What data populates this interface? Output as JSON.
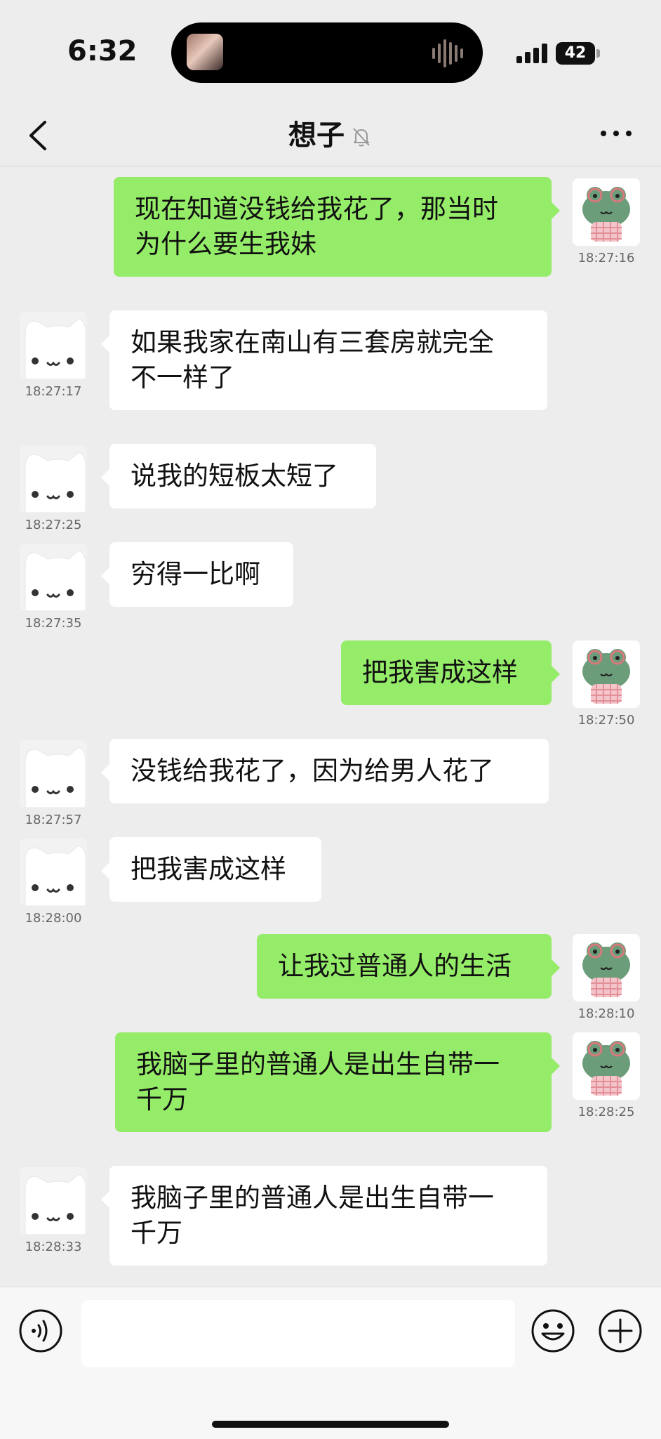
{
  "status_bar": {
    "time": "6:32",
    "battery": "42"
  },
  "nav": {
    "title": "想子"
  },
  "messages": [
    {
      "text": "现在知道没钱给我花了，那当时\n为什么要生我妹",
      "time": "18:27:16"
    },
    {
      "text": "如果我家在南山有三套房就完全\n不一样了",
      "time": "18:27:17"
    },
    {
      "text": "说我的短板太短了",
      "time": "18:27:25"
    },
    {
      "text": "穷得一比啊",
      "time": "18:27:35"
    },
    {
      "text": "把我害成这样",
      "time": "18:27:50"
    },
    {
      "text": "没钱给我花了，因为给男人花了",
      "time": "18:27:57"
    },
    {
      "text": "把我害成这样",
      "time": "18:28:00"
    },
    {
      "text": "让我过普通人的生活",
      "time": "18:28:10"
    },
    {
      "text": "我脑子里的普通人是出生自带一\n千万",
      "time": "18:28:25"
    },
    {
      "text": "我脑子里的普通人是出生自带一\n千万",
      "time": "18:28:33"
    }
  ],
  "icons": {
    "back": "chevron-left-icon",
    "mute": "bell-off-icon",
    "more": "more-dots-icon",
    "voice": "voice-icon",
    "emoji": "emoji-icon",
    "plus": "plus-icon"
  },
  "colors": {
    "outgoing_bubble": "#95ec69",
    "incoming_bubble": "#ffffff",
    "background": "#ededed"
  }
}
